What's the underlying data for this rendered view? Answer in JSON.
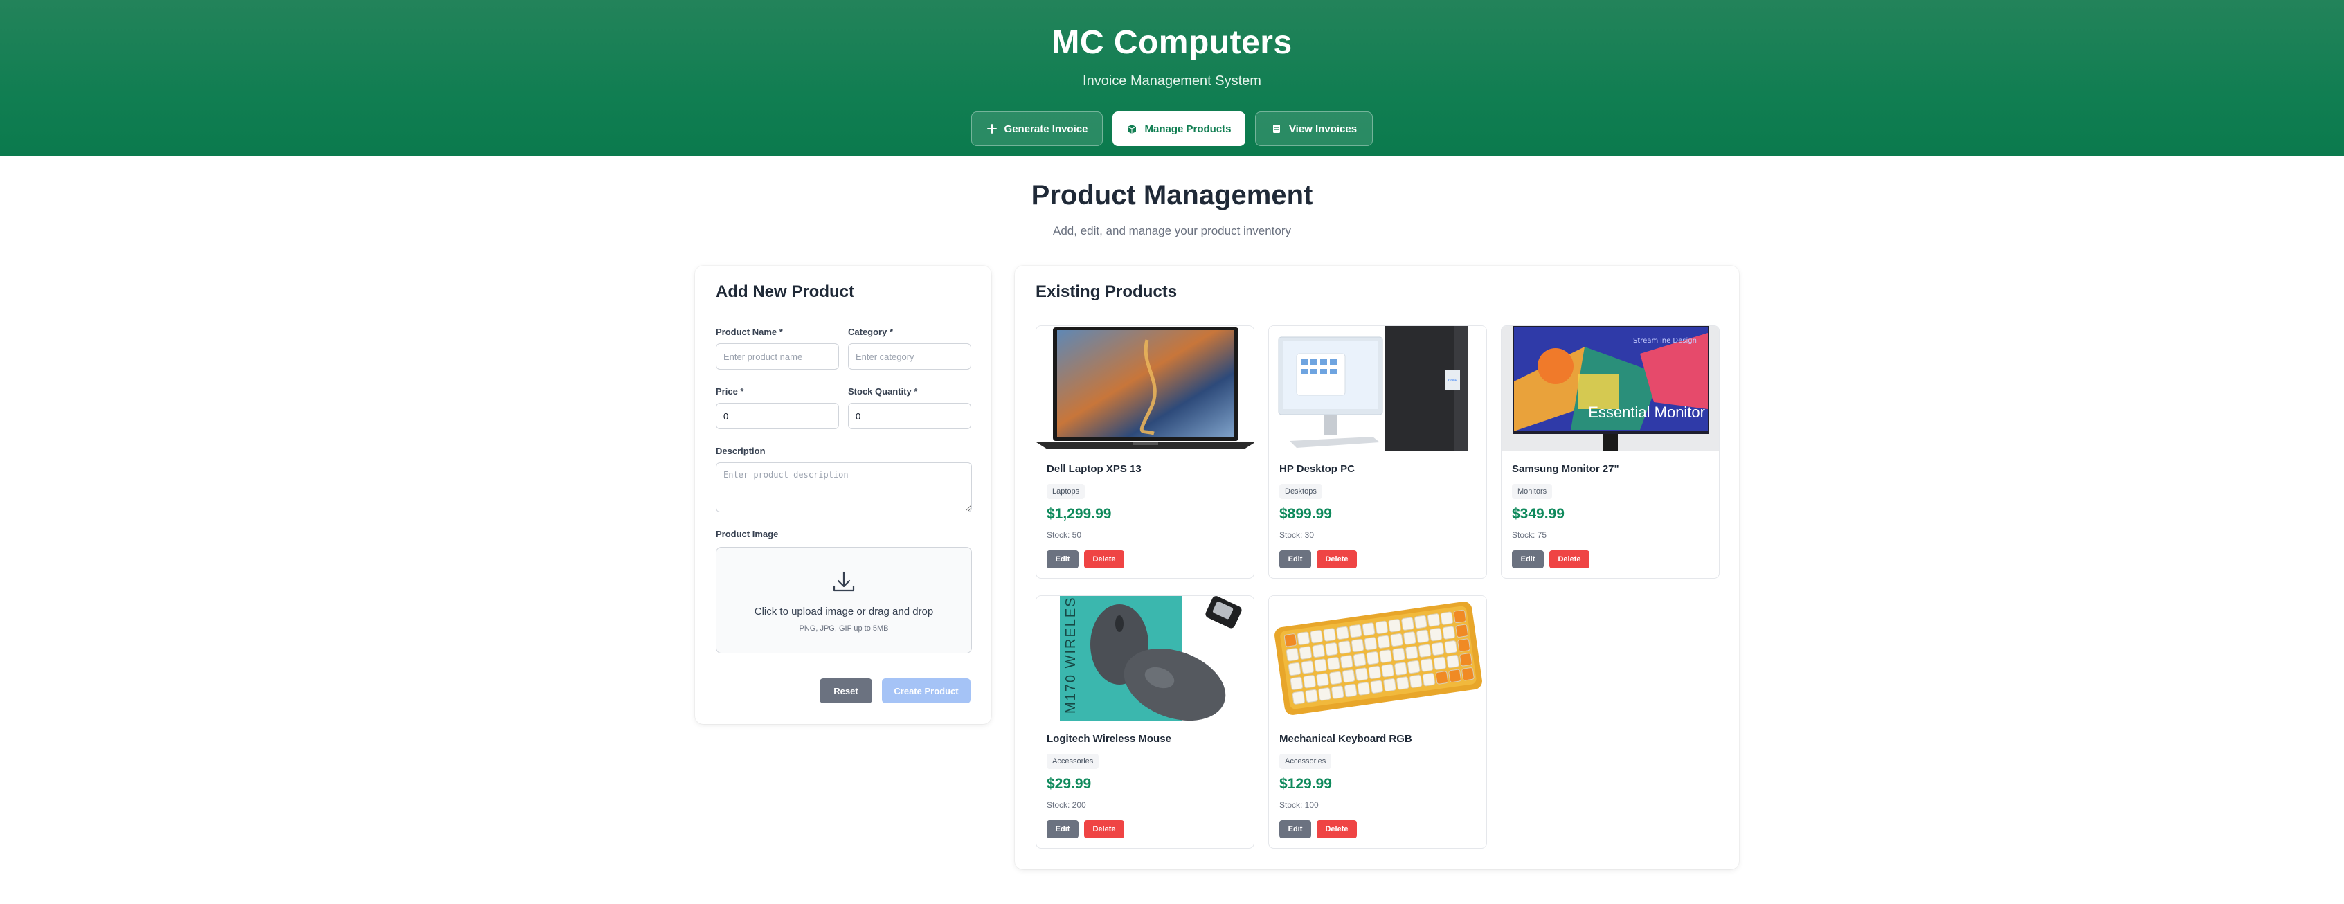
{
  "header": {
    "brand": "MC Computers",
    "tagline": "Invoice Management System",
    "nav": [
      {
        "label": "Generate Invoice",
        "icon": "plus-icon",
        "active": false
      },
      {
        "label": "Manage Products",
        "icon": "box-icon",
        "active": true
      },
      {
        "label": "View Invoices",
        "icon": "document-icon",
        "active": false
      }
    ]
  },
  "page": {
    "title": "Product Management",
    "subtitle": "Add, edit, and manage your product inventory"
  },
  "form": {
    "title": "Add New Product",
    "name_label": "Product Name *",
    "name_placeholder": "Enter product name",
    "category_label": "Category *",
    "category_placeholder": "Enter category",
    "price_label": "Price *",
    "price_value": "0",
    "stock_label": "Stock Quantity *",
    "stock_value": "0",
    "description_label": "Description",
    "description_placeholder": "Enter product description",
    "image_label": "Product Image",
    "upload_text": "Click to upload image or drag and drop",
    "upload_hint": "PNG, JPG, GIF up to 5MB",
    "reset_label": "Reset",
    "create_label": "Create Product"
  },
  "products": {
    "title": "Existing Products",
    "edit_label": "Edit",
    "delete_label": "Delete",
    "items": [
      {
        "name": "Dell Laptop XPS 13",
        "category": "Laptops",
        "price": "$1,299.99",
        "stock": "Stock: 50",
        "image": "laptop"
      },
      {
        "name": "HP Desktop PC",
        "category": "Desktops",
        "price": "$899.99",
        "stock": "Stock: 30",
        "image": "desktop"
      },
      {
        "name": "Samsung Monitor 27\"",
        "category": "Monitors",
        "price": "$349.99",
        "stock": "Stock: 75",
        "image": "monitor",
        "image_text": "Essential Monitor",
        "image_small_text": "Streamline Design"
      },
      {
        "name": "Logitech Wireless Mouse",
        "category": "Accessories",
        "price": "$29.99",
        "stock": "Stock: 200",
        "image": "mouse",
        "image_text": "M170 WIRELESS"
      },
      {
        "name": "Mechanical Keyboard RGB",
        "category": "Accessories",
        "price": "$129.99",
        "stock": "Stock: 100",
        "image": "keyboard"
      }
    ]
  },
  "colors": {
    "header_green": "#117e52",
    "price_green": "#0f8a5c",
    "delete_red": "#ef4444",
    "edit_gray": "#6b7280",
    "create_blue": "#a5c3f6"
  }
}
